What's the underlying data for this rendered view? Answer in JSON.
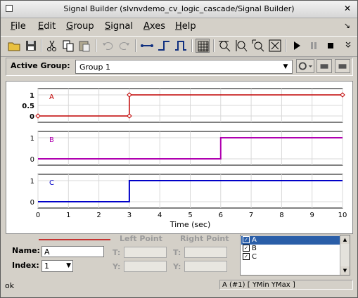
{
  "window": {
    "title": "Signal Builder (slvnvdemo_cv_logic_cascade/Signal Builder)"
  },
  "menu": [
    "File",
    "Edit",
    "Group",
    "Signal",
    "Axes",
    "Help"
  ],
  "menu_underline": [
    "F",
    "E",
    "G",
    "S",
    "A",
    "H"
  ],
  "toolbar": {
    "icons": [
      "open-icon",
      "save-icon",
      "cut-icon",
      "copy-icon",
      "paste-icon",
      "undo-icon",
      "redo-icon",
      "segment-icon",
      "step-icon",
      "pulse-icon",
      "grid-icon",
      "zoom-x-icon",
      "zoom-y-icon",
      "zoom-xy-icon",
      "fit-icon",
      "play-icon",
      "pause-icon",
      "stop-icon"
    ]
  },
  "group": {
    "label": "Active Group:",
    "value": "Group 1"
  },
  "signal_panel": {
    "name_label": "Name:",
    "name_value": "A",
    "index_label": "Index:",
    "index_value": "1",
    "left_point": "Left Point",
    "right_point": "Right Point",
    "t_label": "T:",
    "y_label": "Y:",
    "signals": [
      {
        "label": "A",
        "checked": true,
        "selected": true
      },
      {
        "label": "B",
        "checked": true,
        "selected": false
      },
      {
        "label": "C",
        "checked": true,
        "selected": false
      }
    ]
  },
  "status": {
    "left": "ok",
    "right": "A (#1)  [ YMin YMax ]"
  },
  "colors": {
    "A": "#c00000",
    "B": "#b000b0",
    "C": "#0000c8",
    "selection": "#2a5ea8"
  },
  "chart_data": {
    "type": "line",
    "xlabel": "Time (sec)",
    "xlim": [
      0,
      10
    ],
    "x_ticks": [
      0,
      1,
      2,
      3,
      4,
      5,
      6,
      7,
      8,
      9,
      10
    ],
    "y_ticks_A": [
      0,
      0.5,
      1
    ],
    "y_ticks_BC": [
      0,
      1
    ],
    "ylim": [
      0,
      1
    ],
    "grid": true,
    "series": [
      {
        "name": "A",
        "x": [
          0,
          3,
          3,
          10
        ],
        "y": [
          0,
          0,
          1,
          1
        ],
        "color": "#c00000"
      },
      {
        "name": "B",
        "x": [
          0,
          6,
          6,
          10
        ],
        "y": [
          0,
          0,
          1,
          1
        ],
        "color": "#b000b0"
      },
      {
        "name": "C",
        "x": [
          0,
          3,
          3,
          10
        ],
        "y": [
          0,
          0,
          1,
          1
        ],
        "color": "#0000c8"
      }
    ]
  }
}
